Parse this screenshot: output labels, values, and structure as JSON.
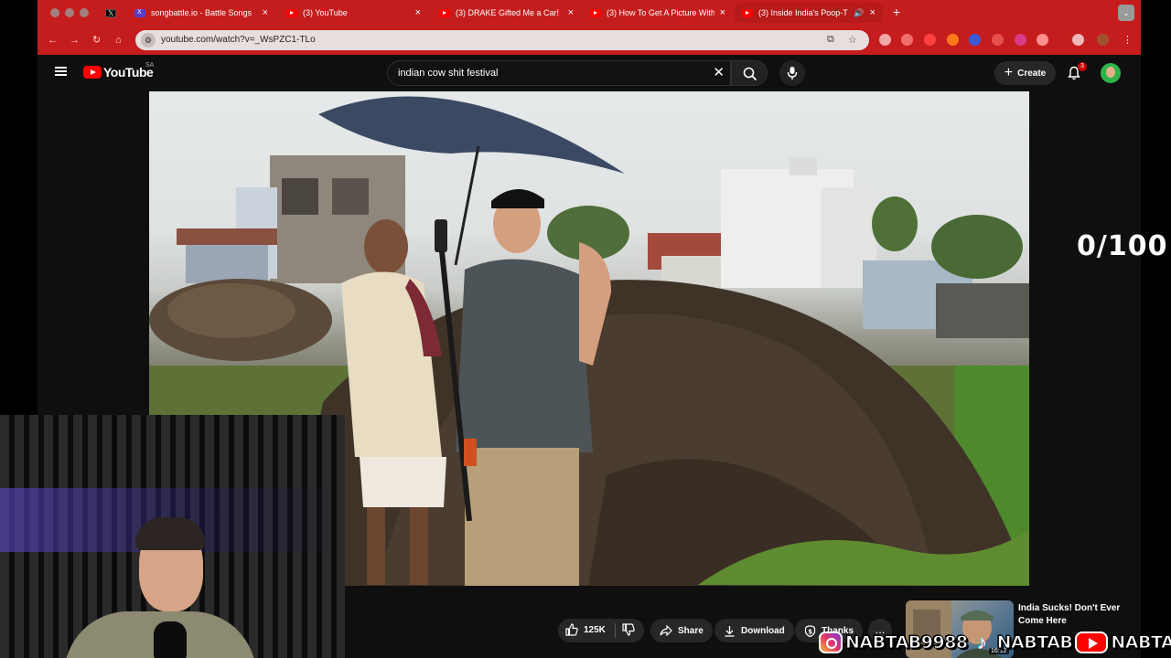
{
  "browser": {
    "tabs": [
      {
        "title": "",
        "icon": "x-logo-icon",
        "active": false
      },
      {
        "title": "songbattle.io - Battle Songs",
        "icon": "songbattle-icon",
        "active": false
      },
      {
        "title": "(3) YouTube",
        "icon": "youtube-icon",
        "active": false
      },
      {
        "title": "(3) DRAKE Gifted Me a Car!",
        "icon": "youtube-icon",
        "active": false
      },
      {
        "title": "(3) How To Get A Picture With",
        "icon": "youtube-icon",
        "active": false
      },
      {
        "title": "(3) Inside India's Poop-T",
        "icon": "youtube-icon",
        "active": true
      }
    ],
    "url": "youtube.com/watch?v=_WsPZC1-TLo",
    "accent": "#c51d1d"
  },
  "youtube": {
    "logo_text": "YouTube",
    "country": "SA",
    "search_query": "indian cow shit festival",
    "create_label": "Create",
    "notification_count": "3"
  },
  "overlay": {
    "score": "0/100"
  },
  "actions": {
    "likes": "125K",
    "share": "Share",
    "download": "Download",
    "thanks": "Thanks",
    "more": "..."
  },
  "recommended": {
    "title": "India Sucks! Don't Ever Come Here",
    "duration": "16:12"
  },
  "social": {
    "instagram": "NABTAB9988",
    "tiktok": "NABTAB",
    "youtube": "NABTAB"
  }
}
